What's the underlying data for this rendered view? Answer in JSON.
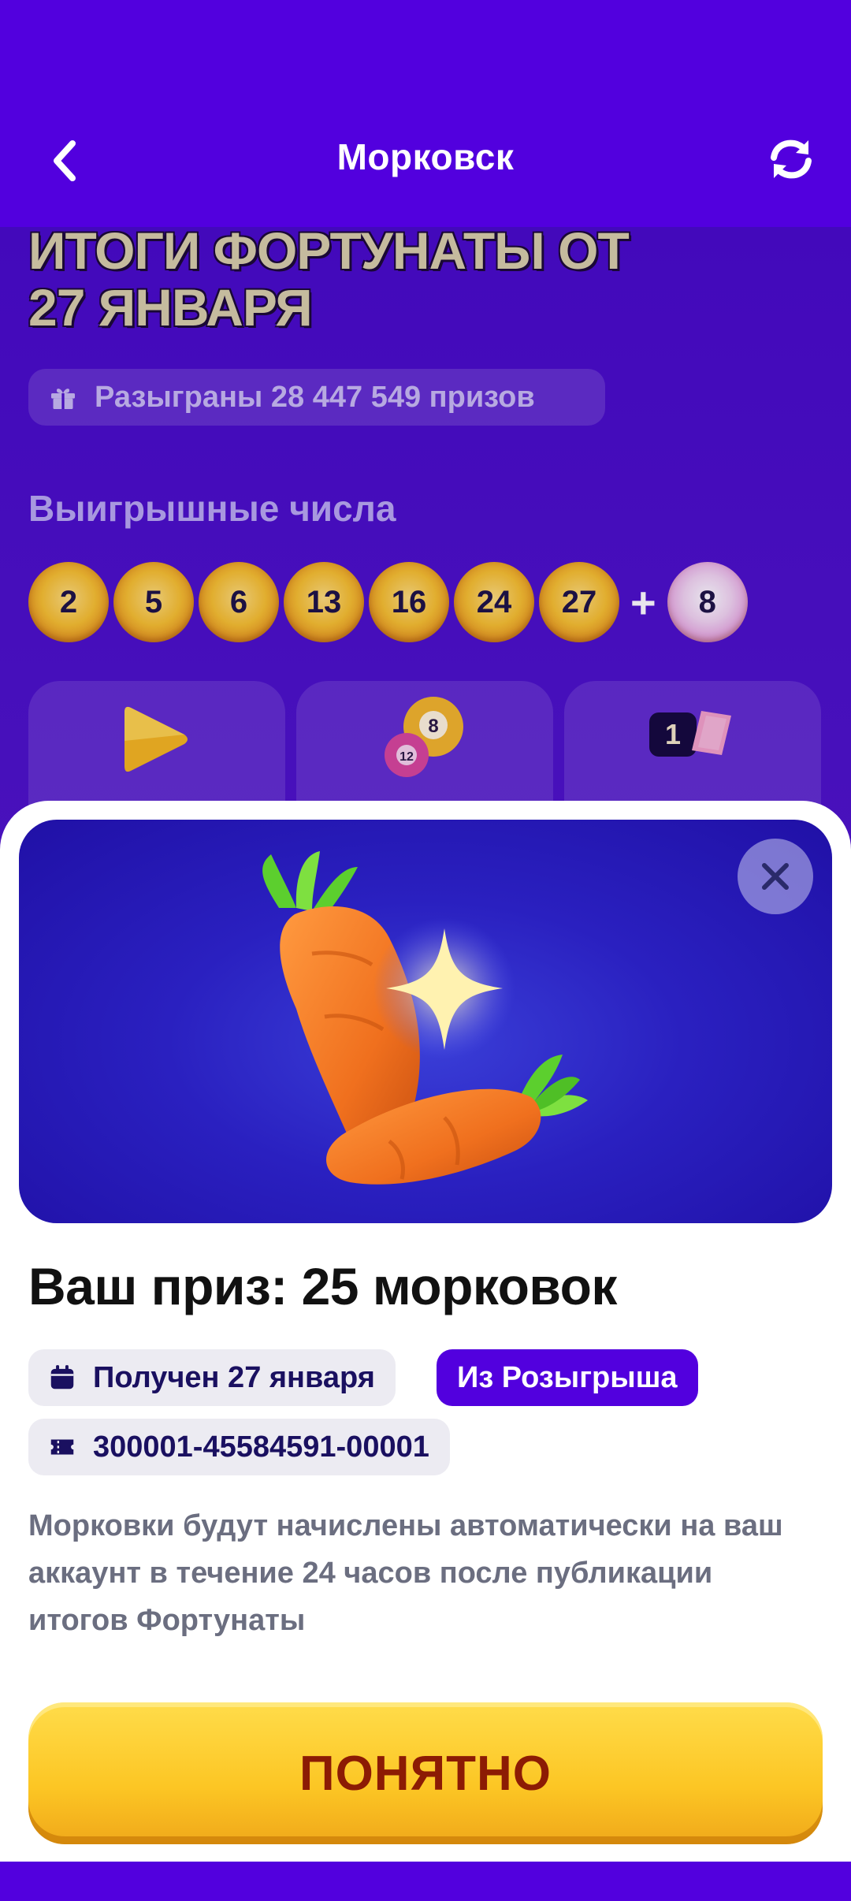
{
  "header": {
    "title": "Морковск",
    "back_icon": "chevron-left-icon",
    "refresh_icon": "refresh-icon"
  },
  "results": {
    "title_line1": "ИТОГИ ФОРТУНАТЫ ОТ",
    "title_line2": "27 ЯНВАРЯ",
    "prizes_text": "Разыграны 28 447 549 призов",
    "winning_label": "Выигрышные числа",
    "numbers": [
      "2",
      "5",
      "6",
      "13",
      "16",
      "24",
      "27"
    ],
    "plus": "+",
    "bonus_number": "8",
    "card_badge": "1"
  },
  "prize": {
    "title": "Ваш приз: 25 морковок",
    "date_chip": "Получен 27 января",
    "source_chip": "Из Розыгрыша",
    "ticket_number": "300001-45584591-00001",
    "description": "Морковки будут начислены автоматически на ваш аккаунт в течение 24 часов после публикации итогов Фортунаты",
    "button_label": "ПОНЯТНО"
  },
  "colors": {
    "brand_purple": "#5200de",
    "button_yellow": "#fcc624",
    "button_text": "#8c1b04"
  }
}
